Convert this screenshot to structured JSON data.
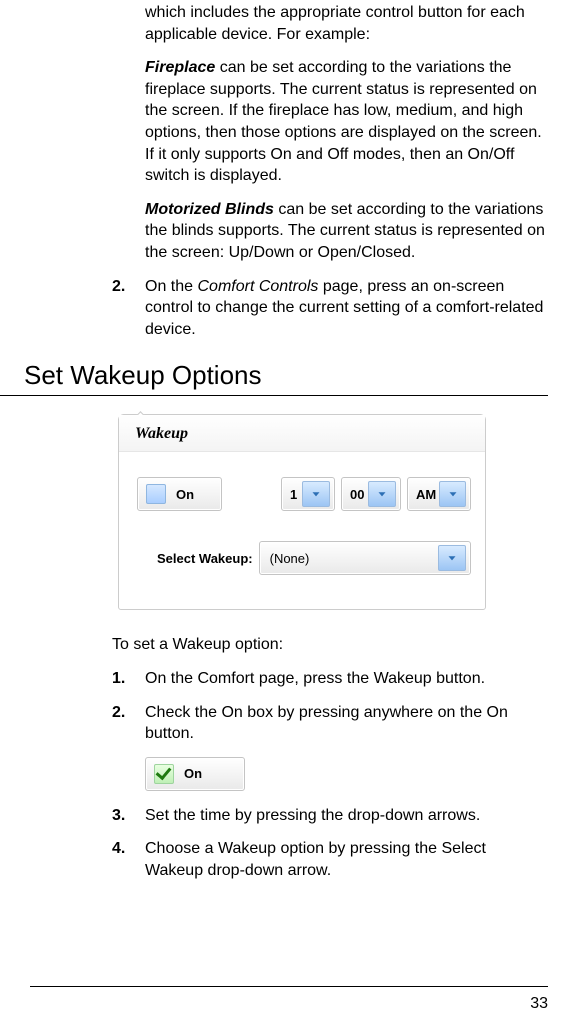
{
  "intro": {
    "lead_in": "which includes the appropriate control button for each applicable device. For example:",
    "fireplace_term": "Fireplace",
    "fireplace_body": " can be set according to the variations the fireplace supports. The current status is represented on the screen. If the fireplace has low, medium, and high options, then those options are displayed on the screen. If it only supports On and Off modes, then an On/Off switch is displayed.",
    "blinds_term": "Motorized Blinds",
    "blinds_body": " can be set according to the variations the blinds supports. The current status is represented on the screen: Up/Down or Open/Closed."
  },
  "step2": {
    "num": "2.",
    "text_a": "On the ",
    "text_i": "Comfort Controls",
    "text_b": " page, press an on-screen control to change the current setting of a comfort-related device."
  },
  "heading": "Set Wakeup Options",
  "wakeup_panel": {
    "tab_label": "Wakeup",
    "on_label": "On",
    "hour": "1",
    "minute": "00",
    "ampm": "AM",
    "select_wakeup_label": "Select Wakeup:",
    "select_wakeup_value": "(None)"
  },
  "wakeup_steps": {
    "intro": "To set a Wakeup option:",
    "s1": {
      "num": "1.",
      "text": "On the Comfort page, press the Wakeup button."
    },
    "s2": {
      "num": "2.",
      "text": "Check the On box by pressing anywhere on the On button."
    },
    "on_label_inline": "On",
    "s3": {
      "num": "3.",
      "text": "Set the time by pressing the drop-down arrows."
    },
    "s4": {
      "num": "4.",
      "text": "Choose a Wakeup option by pressing the Select Wakeup drop-down arrow."
    }
  },
  "page_number": "33"
}
